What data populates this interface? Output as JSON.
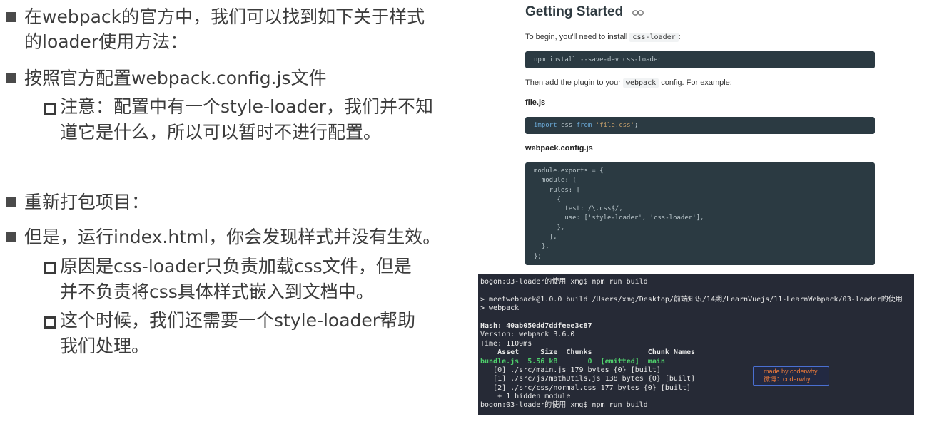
{
  "slide": {
    "bullets": [
      {
        "text": "在webpack的官方中，我们可以找到如下关于样式的loader使用方法："
      },
      {
        "text": "按照官方配置webpack.config.js文件"
      },
      {
        "text": "重新打包项目："
      },
      {
        "text": "但是，运行index.html，你会发现样式并没有生效。"
      }
    ],
    "subbullets": [
      {
        "text": "注意：配置中有一个style-loader，我们并不知道它是什么，所以可以暂时不进行配置。"
      },
      {
        "text": "原因是css-loader只负责加载css文件，但是并不负责将css具体样式嵌入到文档中。"
      },
      {
        "text": "这个时候，我们还需要一个style-loader帮助我们处理。"
      }
    ]
  },
  "docs": {
    "title": "Getting Started",
    "intro_prefix": "To begin, you'll need to install ",
    "intro_code": "css-loader",
    "intro_suffix": ":",
    "install_cmd": "npm install --save-dev css-loader",
    "then_prefix": "Then add the plugin to your ",
    "then_code": "webpack",
    "then_suffix": " config. For example:",
    "file1": "file.js",
    "file1_code": {
      "kw1": "import",
      "mid": " css ",
      "kw2": "from",
      "str": "'file.css'",
      "end": ";"
    },
    "file2": "webpack.config.js",
    "config_lines": [
      "module.exports = {",
      "  module: {",
      "    rules: [",
      "      {",
      "        test: /\\.css$/,",
      "        use: ['style-loader', 'css-loader'],",
      "      },",
      "    ],",
      "  },",
      "};"
    ]
  },
  "terminal": {
    "lines": [
      "bogon:03-loader的使用 xmg$ npm run build",
      "",
      "> meetwebpack@1.0.0 build /Users/xmg/Desktop/前端知识/14期/LearnVuejs/11-LearnWebpack/03-loader的使用",
      "> webpack",
      "",
      "Hash: 40ab050dd7ddfeee3c87",
      "Version: webpack 3.6.0",
      "Time: 1109ms",
      "    Asset     Size  Chunks             Chunk Names",
      "bundle.js  5.56 kB       0  [emitted]  main",
      "   [0] ./src/main.js 179 bytes {0} [built]",
      "   [1] ./src/js/mathUtils.js 138 bytes {0} [built]",
      "   [2] ./src/css/normal.css 177 bytes {0} [built]",
      "    + 1 hidden module",
      "bogon:03-loader的使用 xmg$ npm run build"
    ],
    "watermark_line1": "made by coderwhy",
    "watermark_line2": "微博：coderwhy"
  },
  "colors": {
    "terminal_bg": "#262a36",
    "code_bg": "#2b3a42",
    "built_green": "#4fd06c"
  }
}
